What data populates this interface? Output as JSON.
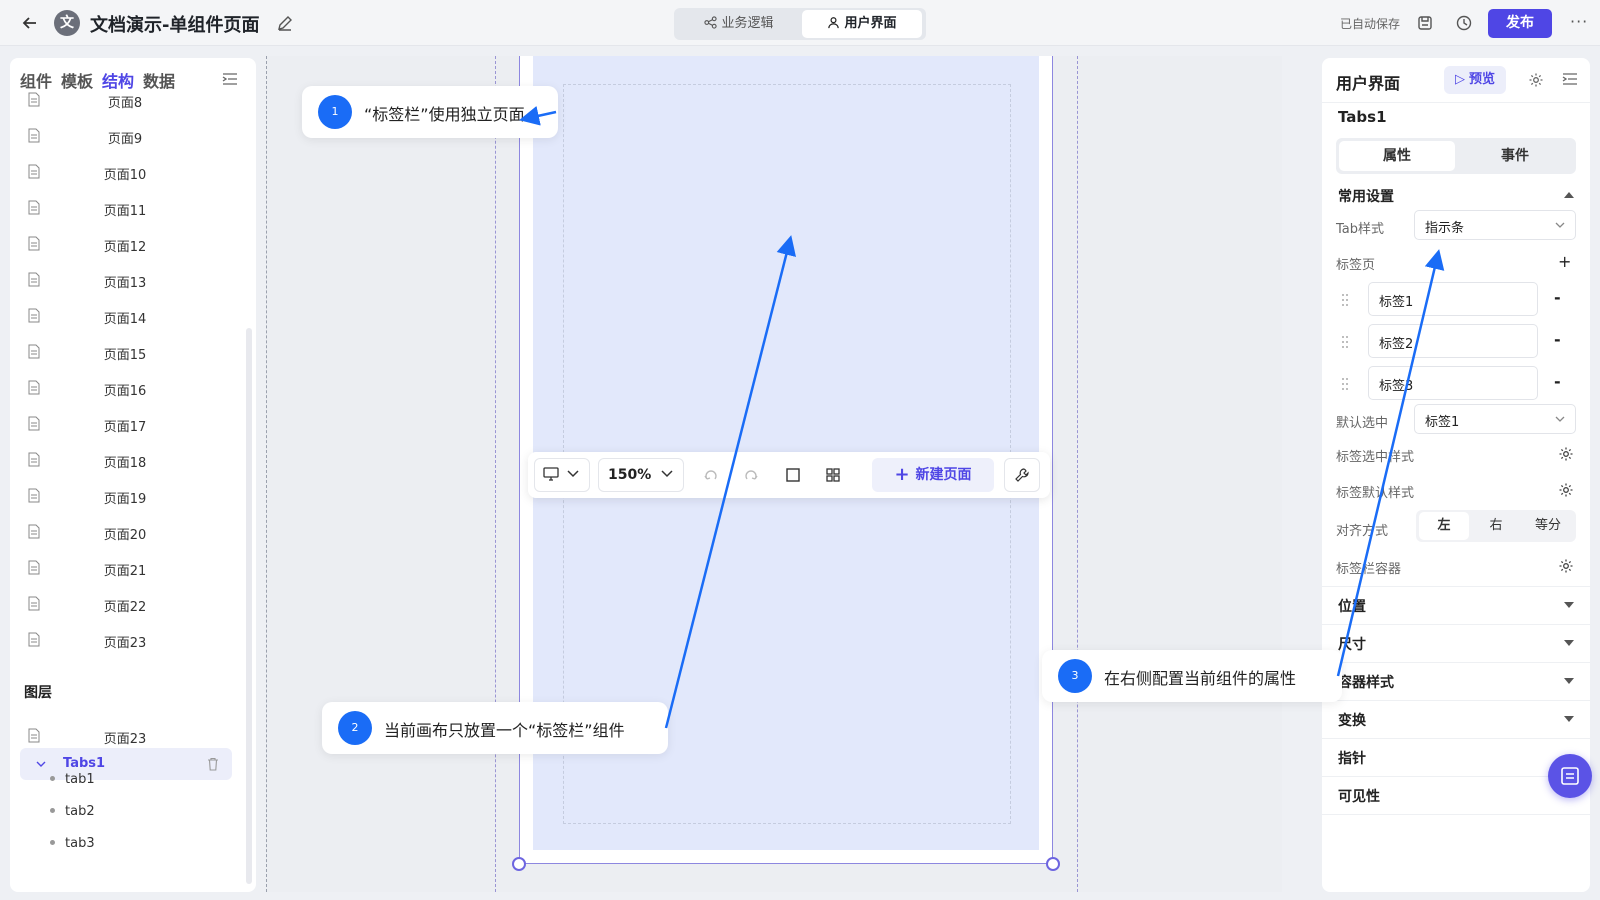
{
  "header": {
    "app_logo_char": "文",
    "title": "文档演示-单组件页面",
    "mode_logic": "业务逻辑",
    "mode_ui": "用户界面",
    "autosave": "已自动保存",
    "publish": "发布"
  },
  "left": {
    "tabs": [
      "组件",
      "模板",
      "结构",
      "数据"
    ],
    "active_tab": "结构",
    "pages": [
      "页面8",
      "页面9",
      "页面10",
      "页面11",
      "页面12",
      "页面13",
      "页面14",
      "页面15",
      "页面16",
      "页面17",
      "页面18",
      "页面19",
      "页面20",
      "页面21",
      "页面22",
      "页面23"
    ],
    "layers_title": "图层",
    "layer_page": "页面23",
    "layer_component": "Tabs1",
    "layer_children": [
      "tab1",
      "tab2",
      "tab3"
    ]
  },
  "toolbar": {
    "zoom": "150%",
    "new_page": "新建页面"
  },
  "callouts": [
    {
      "num": "1",
      "text": "“标签栏”使用独立页面"
    },
    {
      "num": "2",
      "text": "当前画布只放置一个“标签栏”组件"
    },
    {
      "num": "3",
      "text": "在右侧配置当前组件的属性"
    }
  ],
  "right": {
    "title": "用户界面",
    "preview": "预览",
    "component_name": "Tabs1",
    "seg_props": "属性",
    "seg_events": "事件",
    "common_settings": "常用设置",
    "tab_style_label": "Tab样式",
    "tab_style_value": "指示条",
    "tab_pages_label": "标签页",
    "tab_entries": [
      "标签1",
      "标签2",
      "标签3"
    ],
    "default_selected_label": "默认选中",
    "default_selected_value": "标签1",
    "selected_style_label": "标签选中样式",
    "default_style_label": "标签默认样式",
    "align_label": "对齐方式",
    "align_options": [
      "左",
      "右",
      "等分"
    ],
    "align_active": "左",
    "container_label": "标签栏容器",
    "sections": [
      "位置",
      "尺寸",
      "容器样式",
      "变换",
      "指针",
      "可见性"
    ]
  },
  "colors": {
    "accent": "#4f46e5",
    "annotation": "#1a6cf6"
  }
}
